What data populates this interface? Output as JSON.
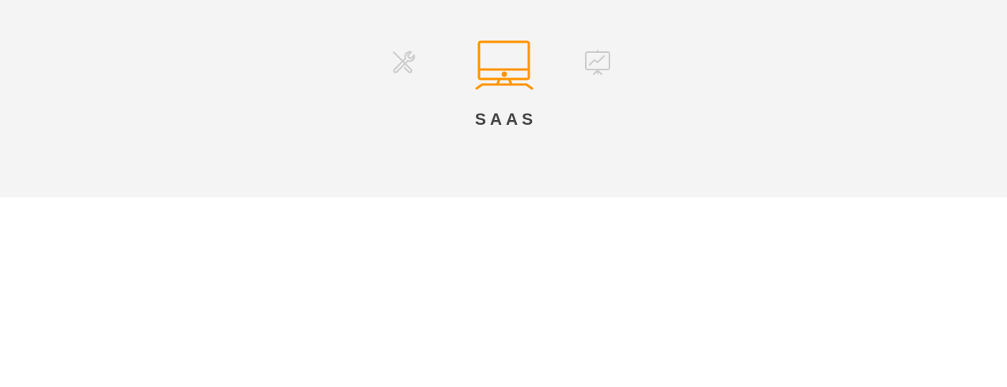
{
  "tabs": [
    {
      "icon": "tools-icon",
      "label": ""
    },
    {
      "icon": "monitor-icon",
      "label": "SAAS",
      "active": true
    },
    {
      "icon": "presentation-chart-icon",
      "label": ""
    }
  ],
  "colors": {
    "active": "#ff9500",
    "inactive": "#cccccc"
  }
}
